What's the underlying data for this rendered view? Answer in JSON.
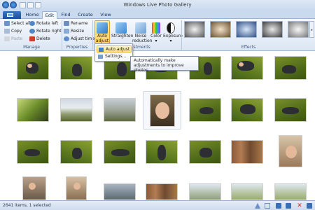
{
  "window": {
    "title": "Windows Live Photo Gallery"
  },
  "tabs": [
    {
      "label": "Home"
    },
    {
      "label": "Edit"
    },
    {
      "label": "Find"
    },
    {
      "label": "Create"
    },
    {
      "label": "View"
    }
  ],
  "ribbon": {
    "manage": {
      "label": "Manage",
      "select_all": "Select all",
      "copy": "Copy",
      "paste": "Paste",
      "rotate_left": "Rotate left",
      "rotate_right": "Rotate right",
      "delete": "Delete"
    },
    "properties": {
      "label": "Properties",
      "rename": "Rename",
      "resize": "Resize",
      "adjust_time": "Adjust time"
    },
    "adjustments": {
      "label": "Adjustments",
      "auto_adjust": "Auto adjust",
      "straighten": "Straighten",
      "noise_reduction": "Noise reduction",
      "color": "Color",
      "exposure": "Exposure"
    },
    "effects": {
      "label": "Effects"
    }
  },
  "dropdown": {
    "items": [
      "Auto adjust",
      "Settings..."
    ]
  },
  "tooltip": {
    "text": "Automatically make adjustments to improve photos."
  },
  "status": {
    "text": "2641 items, 1 selected"
  }
}
